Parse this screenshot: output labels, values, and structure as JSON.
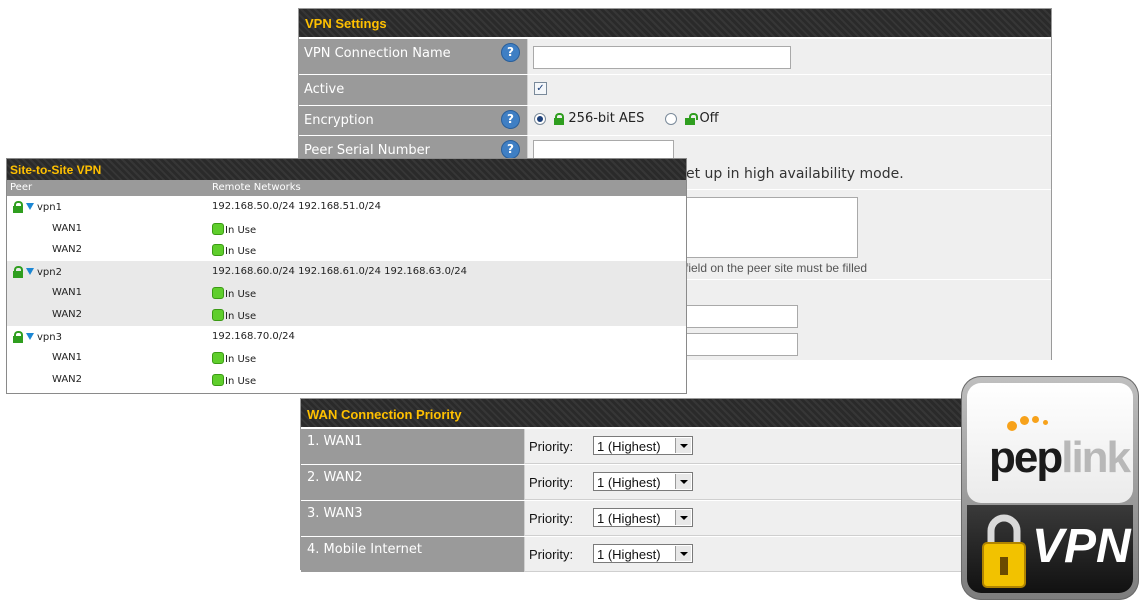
{
  "vpn_settings": {
    "title": "VPN Settings",
    "rows": {
      "name_label": "VPN Connection Name",
      "active_label": "Active",
      "encryption_label": "Encryption",
      "peer_serial_label": "Peer Serial Number"
    },
    "connection_name_value": "",
    "active_checked": true,
    "encryption_options": [
      "256-bit AES",
      "Off"
    ],
    "encryption_selected": "256-bit AES",
    "peer_serial_value": "",
    "ha_note_fragment": "et up in high availability mode.",
    "peer_note_fragment": "field on the peer site must be filled"
  },
  "site_to_site": {
    "title": "Site-to-Site VPN",
    "columns": [
      "Peer",
      "Remote Networks"
    ],
    "peers": [
      {
        "name": "vpn1",
        "networks": "192.168.50.0/24  192.168.51.0/24",
        "wans": [
          {
            "name": "WAN1",
            "status": "In Use"
          },
          {
            "name": "WAN2",
            "status": "In Use"
          }
        ]
      },
      {
        "name": "vpn2",
        "networks": "192.168.60.0/24  192.168.61.0/24  192.168.63.0/24",
        "wans": [
          {
            "name": "WAN1",
            "status": "In Use"
          },
          {
            "name": "WAN2",
            "status": "In Use"
          }
        ]
      },
      {
        "name": "vpn3",
        "networks": "192.168.70.0/24",
        "wans": [
          {
            "name": "WAN1",
            "status": "In Use"
          },
          {
            "name": "WAN2",
            "status": "In Use"
          }
        ]
      }
    ],
    "status_color": "#5fce2c"
  },
  "wan_priority": {
    "title": "WAN Connection Priority",
    "priority_label": "Priority:",
    "rows": [
      {
        "label": "1. WAN1",
        "value": "1 (Highest)"
      },
      {
        "label": "2. WAN2",
        "value": "1 (Highest)"
      },
      {
        "label": "3. WAN3",
        "value": "1 (Highest)"
      },
      {
        "label": "4. Mobile Internet",
        "value": "1 (Highest)"
      }
    ]
  },
  "badge": {
    "brand_dark": "pep",
    "brand_light": "link",
    "product": "VPN",
    "accent": "#f7a21b"
  },
  "colors": {
    "header_text": "#ffc000",
    "header_bg": "#2a2a2a",
    "label_bg": "#9a9a9a",
    "help_icon": "#3f7fc4",
    "lock_green": "#2f9e1f",
    "triangle_blue": "#1c87d4"
  }
}
